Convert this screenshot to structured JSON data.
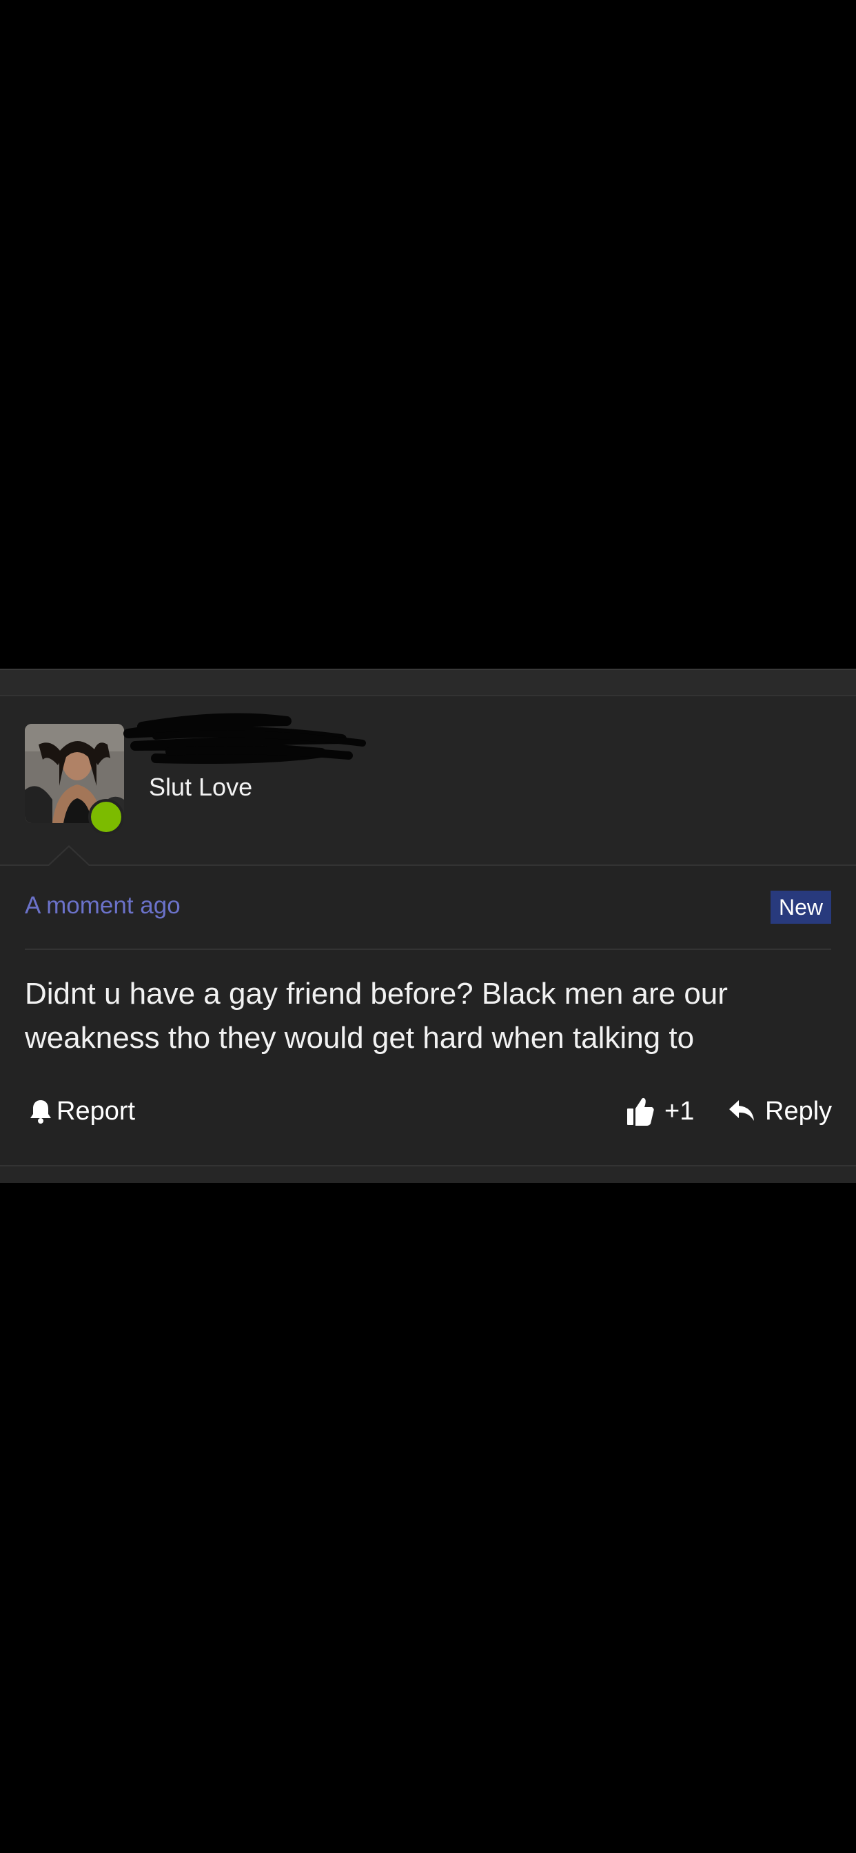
{
  "post": {
    "author_display_name": "Slut Love",
    "author_online": true,
    "timestamp": "A moment ago",
    "badge": "New",
    "message": "Didnt u have a gay friend before? Black men are our weakness tho they would get hard when talking to",
    "actions": {
      "report_label": "Report",
      "like_count": "+1",
      "reply_label": "Reply"
    }
  },
  "colors": {
    "background": "#000000",
    "card": "#232323",
    "timestamp": "#6b72c9",
    "badge": "#283a7d",
    "online": "#7cbb00"
  },
  "icons": {
    "report": "bell-icon",
    "like": "thumbs-up-icon",
    "reply": "reply-arrow-icon"
  }
}
